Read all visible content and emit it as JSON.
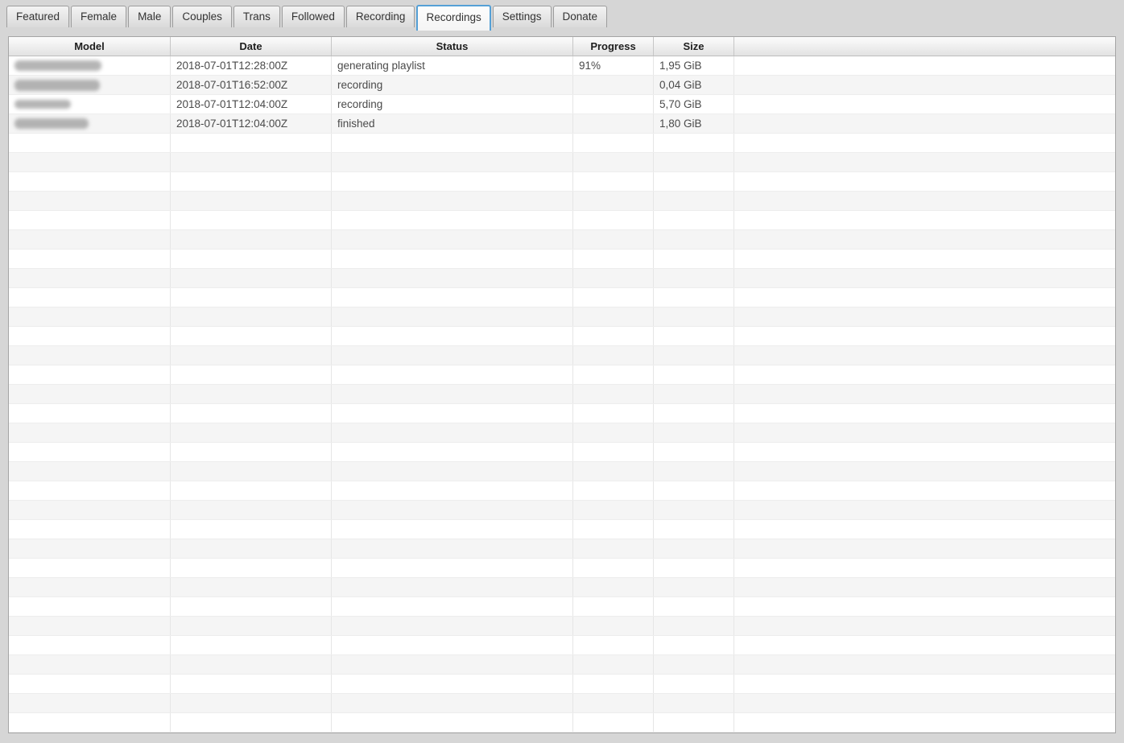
{
  "tabs": [
    {
      "label": "Featured",
      "active": false
    },
    {
      "label": "Female",
      "active": false
    },
    {
      "label": "Male",
      "active": false
    },
    {
      "label": "Couples",
      "active": false
    },
    {
      "label": "Trans",
      "active": false
    },
    {
      "label": "Followed",
      "active": false
    },
    {
      "label": "Recording",
      "active": false
    },
    {
      "label": "Recordings",
      "active": true
    },
    {
      "label": "Settings",
      "active": false
    },
    {
      "label": "Donate",
      "active": false
    }
  ],
  "table": {
    "columns": [
      {
        "label": "Model"
      },
      {
        "label": "Date"
      },
      {
        "label": "Status"
      },
      {
        "label": "Progress"
      },
      {
        "label": "Size"
      },
      {
        "label": ""
      }
    ],
    "rows": [
      {
        "model_redacted": true,
        "date": "2018-07-01T12:28:00Z",
        "status": "generating playlist",
        "progress": "91%",
        "size": "1,95 GiB"
      },
      {
        "model_redacted": true,
        "date": "2018-07-01T16:52:00Z",
        "status": "recording",
        "progress": "",
        "size": "0,04 GiB"
      },
      {
        "model_redacted": true,
        "date": "2018-07-01T12:04:00Z",
        "status": "recording",
        "progress": "",
        "size": "5,70 GiB"
      },
      {
        "model_redacted": true,
        "date": "2018-07-01T12:04:00Z",
        "status": "finished",
        "progress": "",
        "size": "1,80 GiB"
      }
    ]
  },
  "colors": {
    "active_tab_border": "#55a0d6",
    "window_background": "#d6d6d6",
    "row_stripe": "#f5f5f5"
  }
}
